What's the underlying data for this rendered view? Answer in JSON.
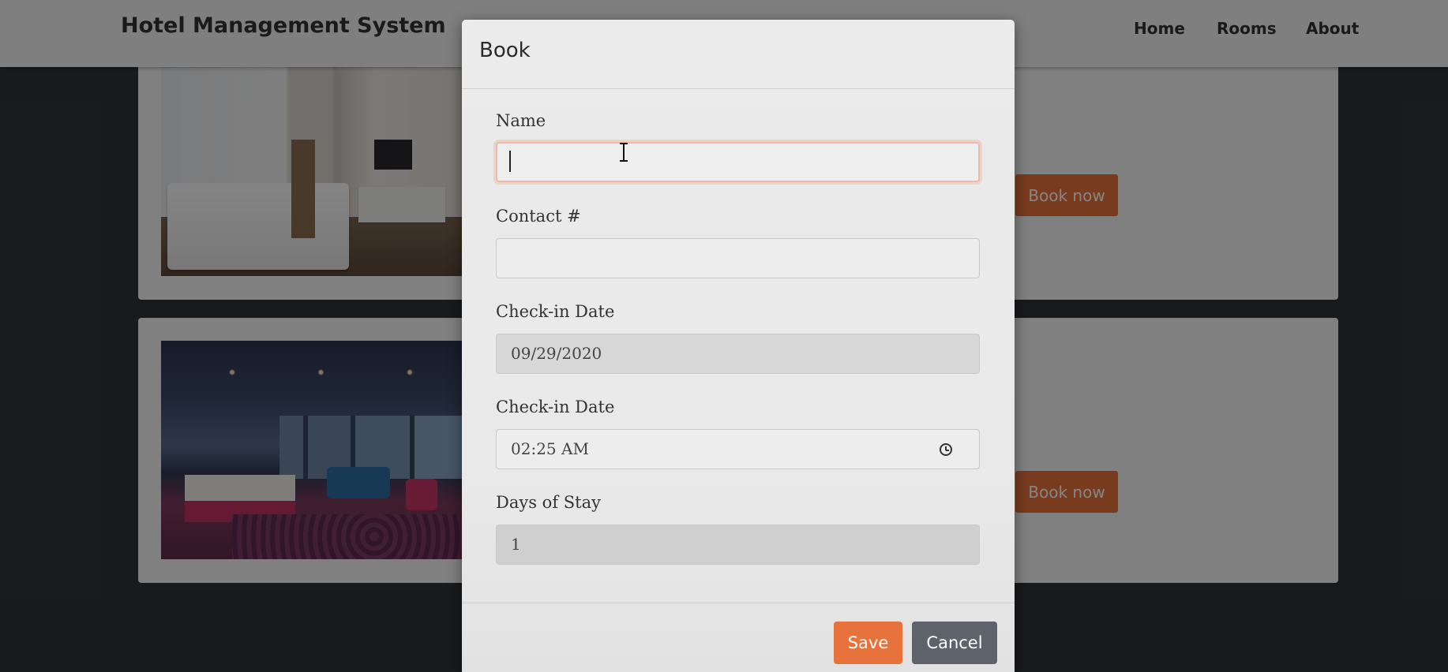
{
  "navbar": {
    "brand": "Hotel Management System",
    "links": [
      "Home",
      "Rooms",
      "About"
    ]
  },
  "rooms": [
    {
      "button_label": "Book now"
    },
    {
      "button_label": "Book now"
    }
  ],
  "modal": {
    "title": "Book",
    "fields": {
      "name": {
        "label": "Name",
        "value": ""
      },
      "contact": {
        "label": "Contact #",
        "value": ""
      },
      "checkin_date": {
        "label": "Check-in Date",
        "value": "09/29/2020"
      },
      "checkin_time": {
        "label": "Check-in Date",
        "value": "02:25 AM"
      },
      "days": {
        "label": "Days of Stay",
        "value": "1"
      }
    },
    "save_label": "Save",
    "cancel_label": "Cancel"
  },
  "colors": {
    "accent": "#e8723b",
    "secondary": "#5e636b"
  }
}
